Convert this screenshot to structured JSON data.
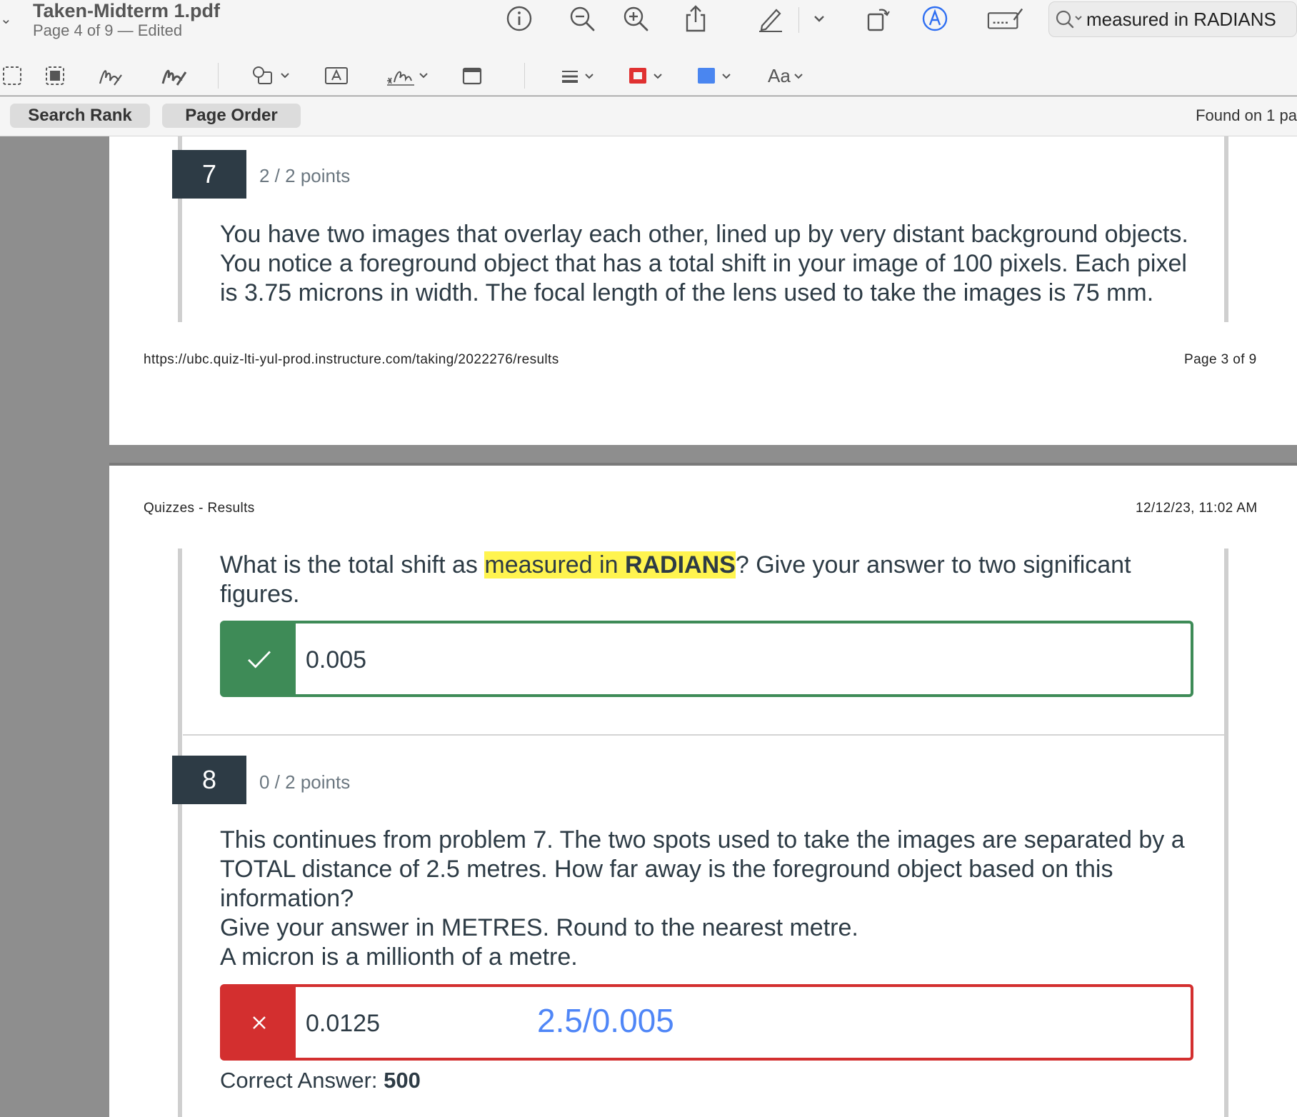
{
  "window": {
    "title": "Taken-Midterm 1.pdf",
    "subtitle": "Page 4 of 9 — Edited"
  },
  "toolbar": {
    "icons": [
      "info-icon",
      "zoom-out-icon",
      "zoom-in-icon",
      "share-icon",
      "pen-icon",
      "chevron-down-icon",
      "rotate-icon",
      "markup-icon",
      "form-fill-icon"
    ],
    "accent_color": "#2f6ff2"
  },
  "search": {
    "value": "measured in RADIANS",
    "placeholder": "Search"
  },
  "markup_toolbar": {
    "font_label": "Aa",
    "border_color": "#e03131",
    "fill_color": "#4a86f0"
  },
  "results_bar": {
    "search_rank_label": "Search Rank",
    "page_order_label": "Page Order",
    "found_text": "Found on 1 pa"
  },
  "page3": {
    "question_number": "7",
    "points": "2 / 2 points",
    "question_lines": [
      "You have two images that overlay each other, lined up by very distant background objects.",
      "You notice a foreground object that has a total shift in your image of 100 pixels. Each pixel",
      "is 3.75 microns in width. The focal length of the lens used to take the images is 75 mm."
    ],
    "footer_url": "https://ubc.quiz-lti-yul-prod.instructure.com/taking/2022276/results",
    "footer_page": "Page 3 of 9"
  },
  "page4": {
    "header_left": "Quizzes - Results",
    "header_right": "12/12/23, 11:02 AM",
    "q7_continued": {
      "text_before": "What is the total shift as ",
      "highlight_plain": "measured in ",
      "highlight_bold": "RADIANS",
      "text_after": "? Give your answer to two significant",
      "line2": "figures.",
      "answer": "0.005",
      "status_color": "#3e8b57"
    },
    "q8": {
      "question_number": "8",
      "points": "0 / 2 points",
      "question_lines": [
        "This continues from problem 7.  The two spots used to take the images are separated by a",
        "TOTAL distance of 2.5 metres.  How far away is the foreground object based on this",
        "information?",
        "Give your answer in METRES. Round to the nearest metre.",
        "A micron is a millionth of a metre."
      ],
      "answer": "0.0125",
      "handwritten_note": "2.5/0.005",
      "status_color": "#d32f2f",
      "correct_answer_label": "Correct Answer:",
      "correct_answer_value": "500"
    }
  }
}
